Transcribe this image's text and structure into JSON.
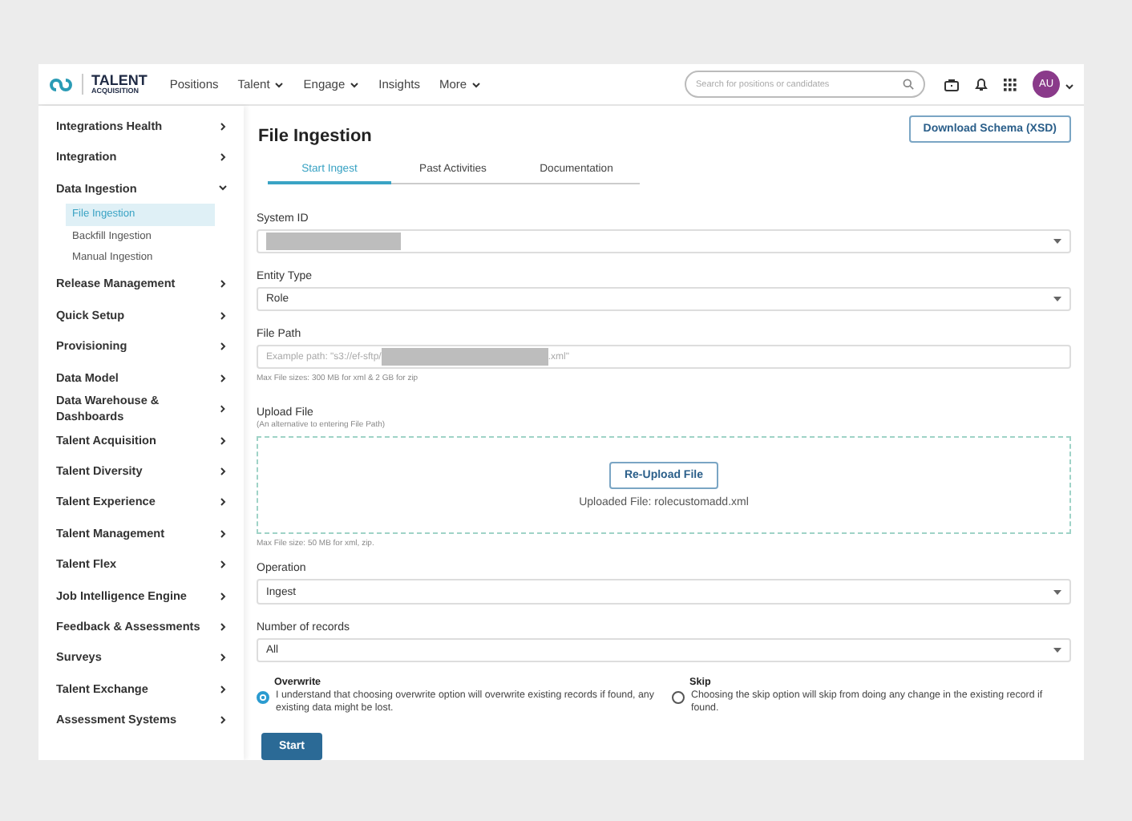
{
  "brand": {
    "line1": "TALENT",
    "line2": "ACQUISITION"
  },
  "nav": [
    {
      "label": "Positions",
      "dropdown": false
    },
    {
      "label": "Talent",
      "dropdown": true
    },
    {
      "label": "Engage",
      "dropdown": true
    },
    {
      "label": "Insights",
      "dropdown": false
    },
    {
      "label": "More",
      "dropdown": true
    }
  ],
  "search": {
    "placeholder": "Search for positions or candidates"
  },
  "user": {
    "initials": "AU"
  },
  "sidebar": [
    {
      "label": "Integrations Health",
      "expanded": false
    },
    {
      "label": "Integration",
      "expanded": false
    },
    {
      "label": "Data Ingestion",
      "expanded": true,
      "children": [
        {
          "label": "File Ingestion",
          "selected": true
        },
        {
          "label": "Backfill Ingestion",
          "selected": false
        },
        {
          "label": "Manual Ingestion",
          "selected": false
        }
      ]
    },
    {
      "label": "Release Management",
      "expanded": false
    },
    {
      "label": "Quick Setup",
      "expanded": false
    },
    {
      "label": "Provisioning",
      "expanded": false
    },
    {
      "label": "Data Model",
      "expanded": false
    },
    {
      "label": "Data Warehouse & Dashboards",
      "expanded": false
    },
    {
      "label": "Talent Acquisition",
      "expanded": false
    },
    {
      "label": "Talent Diversity",
      "expanded": false
    },
    {
      "label": "Talent Experience",
      "expanded": false
    },
    {
      "label": "Talent Management",
      "expanded": false
    },
    {
      "label": "Talent Flex",
      "expanded": false
    },
    {
      "label": "Job Intelligence Engine",
      "expanded": false
    },
    {
      "label": "Feedback & Assessments",
      "expanded": false
    },
    {
      "label": "Surveys",
      "expanded": false
    },
    {
      "label": "Talent Exchange",
      "expanded": false
    },
    {
      "label": "Assessment Systems",
      "expanded": false
    }
  ],
  "page": {
    "title": "File Ingestion",
    "download_button": "Download Schema (XSD)"
  },
  "tabs": [
    {
      "label": "Start Ingest",
      "selected": true
    },
    {
      "label": "Past Activities",
      "selected": false
    },
    {
      "label": "Documentation",
      "selected": false
    }
  ],
  "form": {
    "system_id": {
      "label": "System ID"
    },
    "entity_type": {
      "label": "Entity Type",
      "value": "Role"
    },
    "file_path": {
      "label": "File Path",
      "placeholder_start": "Example path: \"s3://ef-sftp/",
      "placeholder_end": ".xml\"",
      "hint": "Max File sizes: 300 MB for xml & 2 GB for zip"
    },
    "upload": {
      "label": "Upload File",
      "sublabel": "(An alternative to entering File Path)",
      "button": "Re-Upload File",
      "uploaded": "Uploaded File: rolecustomadd.xml",
      "hint": "Max File size: 50 MB for xml, zip."
    },
    "operation": {
      "label": "Operation",
      "value": "Ingest"
    },
    "records": {
      "label": "Number of records",
      "value": "All"
    },
    "options": [
      {
        "title": "Overwrite",
        "text": "I understand that choosing overwrite option will overwrite existing records if found, any existing data might be lost.",
        "selected": true
      },
      {
        "title": "Skip",
        "text": "Choosing the skip option will skip from doing any change in the existing record if found.",
        "selected": false
      }
    ],
    "start_button": "Start"
  }
}
